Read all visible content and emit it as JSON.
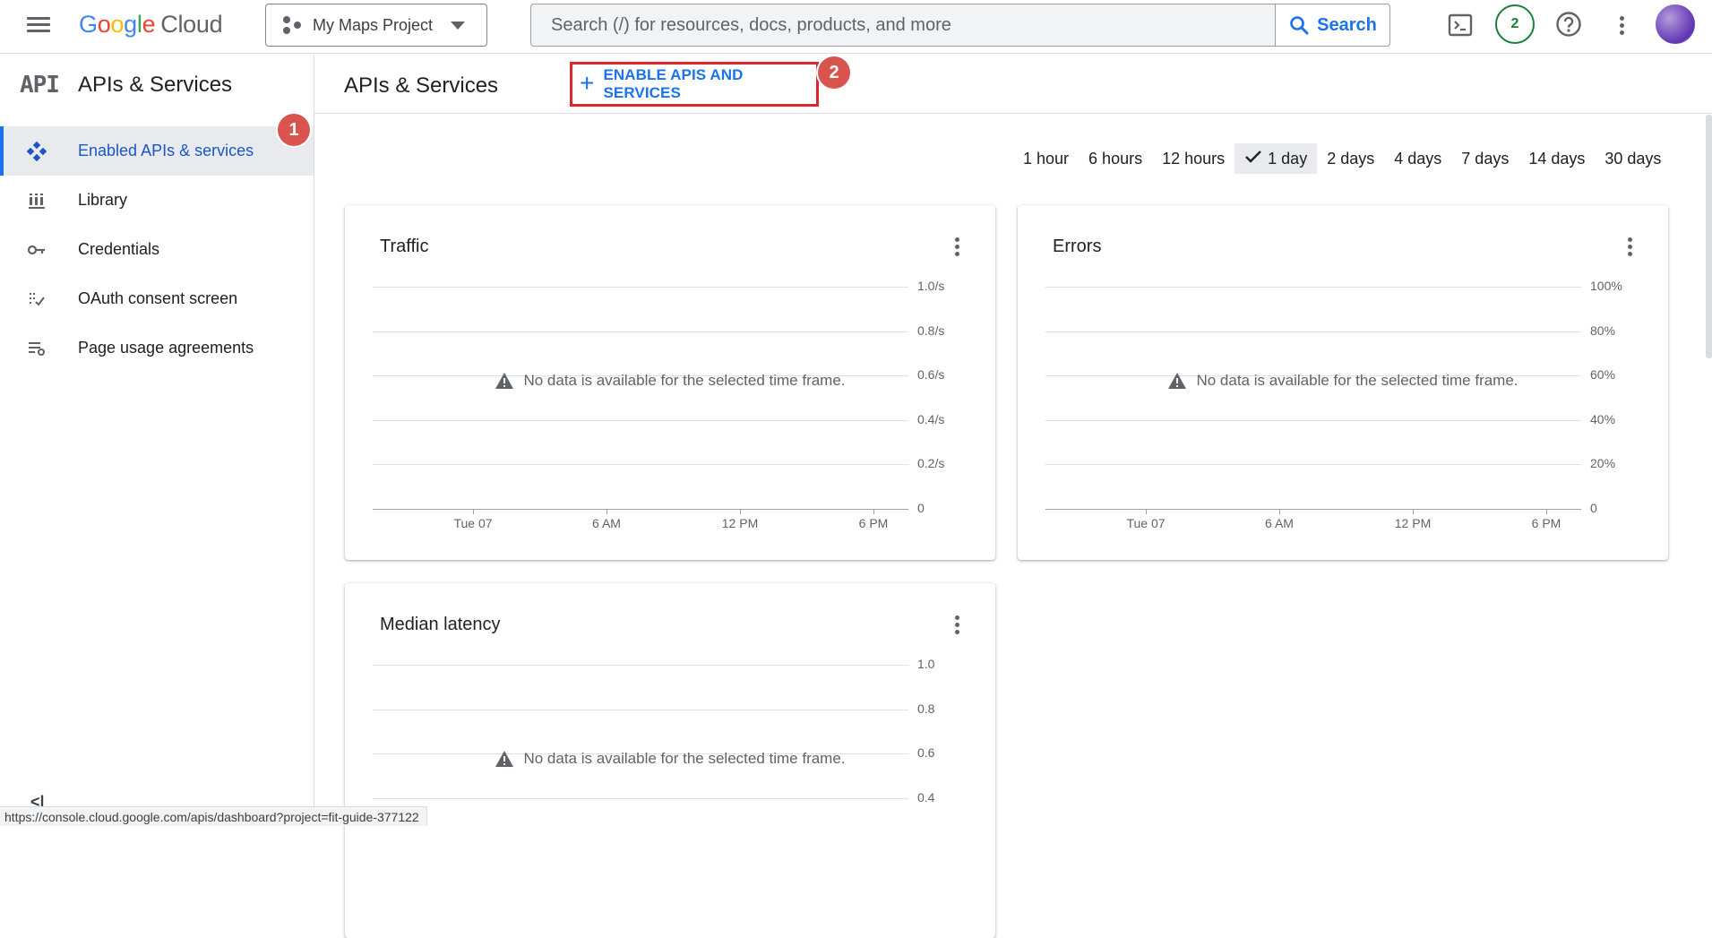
{
  "topbar": {
    "logo_letters": [
      "G",
      "o",
      "o",
      "g",
      "l",
      "e"
    ],
    "logo_suffix": "Cloud",
    "project": "My Maps Project",
    "search_placeholder": "Search (/) for resources, docs, products, and more",
    "search_button": "Search",
    "notification_count": "2"
  },
  "sidebar": {
    "logo": "API",
    "title": "APIs & Services",
    "items": [
      {
        "label": "Enabled APIs & services",
        "icon": "diamond-dots-icon",
        "active": true
      },
      {
        "label": "Library",
        "icon": "library-icon",
        "active": false
      },
      {
        "label": "Credentials",
        "icon": "key-icon",
        "active": false
      },
      {
        "label": "OAuth consent screen",
        "icon": "consent-icon",
        "active": false
      },
      {
        "label": "Page usage agreements",
        "icon": "settings-list-icon",
        "active": false
      }
    ],
    "collapse": "<|"
  },
  "main": {
    "title": "APIs & Services",
    "enable_button": "ENABLE APIS AND SERVICES"
  },
  "annotations": {
    "badge1": "1",
    "badge2": "2"
  },
  "time_range": {
    "options": [
      "1 hour",
      "6 hours",
      "12 hours",
      "1 day",
      "2 days",
      "4 days",
      "7 days",
      "14 days",
      "30 days"
    ],
    "selected": "1 day"
  },
  "cards": [
    {
      "title": "Traffic",
      "y_ticks": [
        "1.0/s",
        "0.8/s",
        "0.6/s",
        "0.4/s",
        "0.2/s",
        "0"
      ],
      "x_ticks": [
        "Tue 07",
        "6 AM",
        "12 PM",
        "6 PM"
      ],
      "no_data": "No data is available for the selected time frame."
    },
    {
      "title": "Errors",
      "y_ticks": [
        "100%",
        "80%",
        "60%",
        "40%",
        "20%",
        "0"
      ],
      "x_ticks": [
        "Tue 07",
        "6 AM",
        "12 PM",
        "6 PM"
      ],
      "no_data": "No data is available for the selected time frame."
    },
    {
      "title": "Median latency",
      "y_ticks": [
        "1.0",
        "0.8",
        "0.6",
        "0.4"
      ],
      "x_ticks": [],
      "no_data": "No data is available for the selected time frame."
    }
  ],
  "status_url": "https://console.cloud.google.com/apis/dashboard?project=fit-guide-377122",
  "colors": {
    "accent": "#1a73e8",
    "highlight_box": "#e0252b",
    "badge": "#d9534f",
    "notification": "#188038"
  }
}
